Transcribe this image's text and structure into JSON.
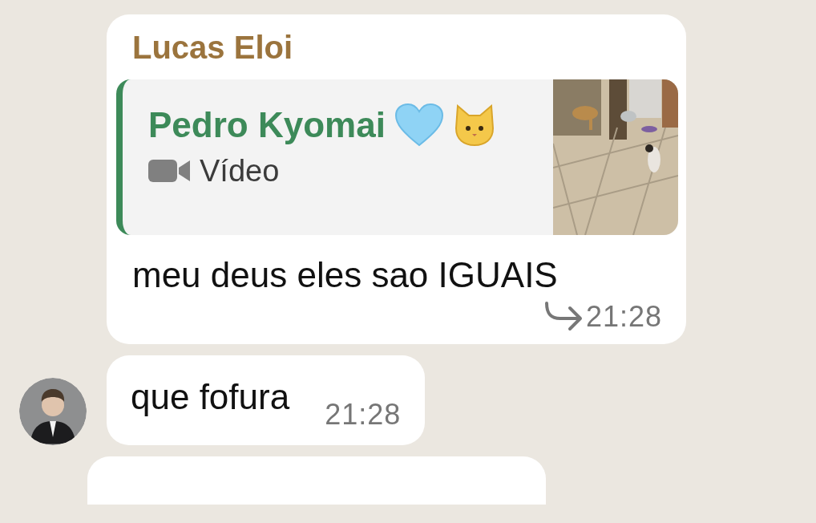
{
  "messages": [
    {
      "kind": "reply",
      "sender": "Lucas Eloi",
      "quote": {
        "author": "Pedro Kyomai",
        "media_label": "Vídeo"
      },
      "text": "meu deus eles sao IGUAIS",
      "time": "21:28",
      "forwarded": true
    },
    {
      "kind": "text",
      "text": "que fofura",
      "time": "21:28",
      "forwarded": false,
      "avatar": true
    },
    {
      "kind": "partial"
    }
  ]
}
